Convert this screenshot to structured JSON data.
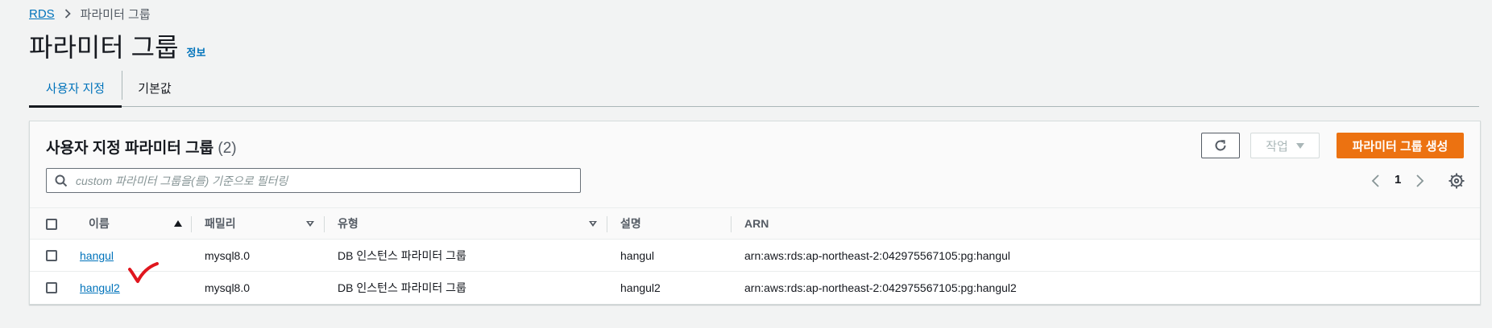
{
  "breadcrumb": {
    "root": "RDS",
    "current": "파라미터 그룹"
  },
  "page": {
    "title": "파라미터 그룹",
    "info_link": "정보"
  },
  "tabs": [
    {
      "label": "사용자 지정",
      "active": true
    },
    {
      "label": "기본값",
      "active": false
    }
  ],
  "panel": {
    "title": "사용자 지정 파라미터 그룹",
    "count": "(2)",
    "refresh_icon": "refresh-icon",
    "actions_label": "작업",
    "create_label": "파라미터 그룹 생성",
    "search_placeholder": "custom 파라미터 그룹을(를) 기준으로 필터링",
    "search_value": "",
    "page_number": "1"
  },
  "table": {
    "columns": [
      "이름",
      "패밀리",
      "유형",
      "설명",
      "ARN"
    ],
    "rows": [
      {
        "name": "hangul",
        "family": "mysql8.0",
        "type": "DB 인스턴스 파라미터 그룹",
        "description": "hangul",
        "arn": "arn:aws:rds:ap-northeast-2:042975567105:pg:hangul"
      },
      {
        "name": "hangul2",
        "family": "mysql8.0",
        "type": "DB 인스턴스 파라미터 그룹",
        "description": "hangul2",
        "arn": "arn:aws:rds:ap-northeast-2:042975567105:pg:hangul2"
      }
    ]
  },
  "colors": {
    "accent": "#0073bb",
    "primary_button": "#ec7211",
    "annotation": "#e0161e"
  }
}
